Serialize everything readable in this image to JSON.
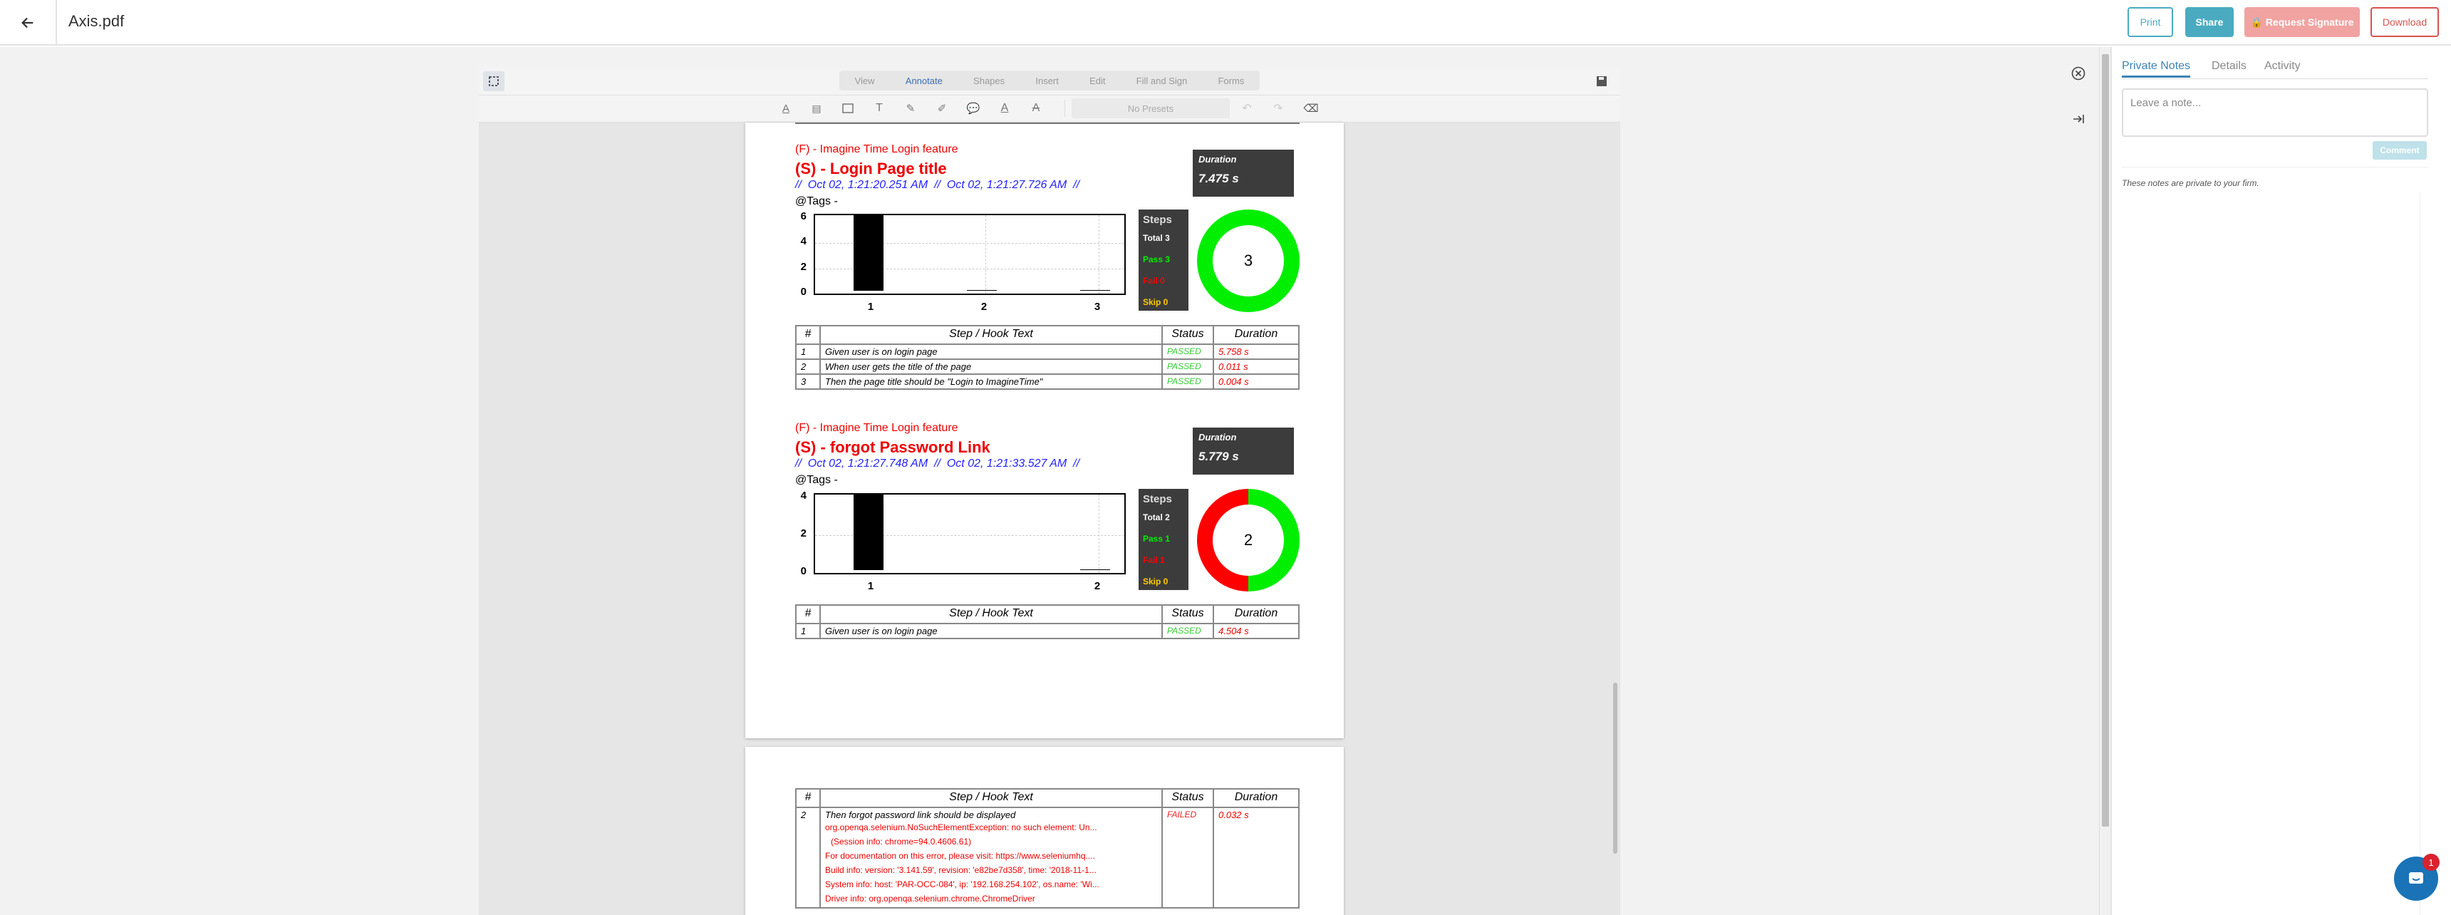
{
  "header": {
    "title": "Axis.pdf",
    "buttons": {
      "print": "Print",
      "share": "Share",
      "request_signature": "Request Signature",
      "download": "Download"
    }
  },
  "toolbar": {
    "tabs": [
      "View",
      "Annotate",
      "Shapes",
      "Insert",
      "Edit",
      "Fill and Sign",
      "Forms"
    ],
    "active_tab": "Annotate",
    "presets": "No Presets"
  },
  "report": {
    "scenario1": {
      "feature": "(F) - Imagine Time Login feature",
      "title": "(S) - Login Page title",
      "time": "//  Oct 02, 1:21:20.251 AM  //  Oct 02, 1:21:27.726 AM  //",
      "tags": "@Tags -",
      "duration_label": "Duration",
      "duration": "7.475 s",
      "steps_label": "Steps",
      "total": "Total 3",
      "pass": "Pass 3",
      "fail": "Fail 0",
      "skip": "Skip 0",
      "donut": "3",
      "chart": {
        "yticks": [
          "6",
          "4",
          "2",
          "0"
        ],
        "xticks": [
          "1",
          "2",
          "3"
        ],
        "values": [
          6,
          0,
          0
        ],
        "ymax": 6
      },
      "headers": [
        "#",
        "Step / Hook Text",
        "Status",
        "Duration"
      ],
      "rows": [
        {
          "n": "1",
          "text": "Given user is on login page",
          "status": "PASSED",
          "dur": "5.758 s"
        },
        {
          "n": "2",
          "text": "When user gets the title of the page",
          "status": "PASSED",
          "dur": "0.011 s"
        },
        {
          "n": "3",
          "text": "Then the page title should be \"Login to ImagineTime\"",
          "status": "PASSED",
          "dur": "0.004 s"
        }
      ]
    },
    "scenario2": {
      "feature": "(F) - Imagine Time Login feature",
      "title": "(S) - forgot Password Link",
      "time": "//  Oct 02, 1:21:27.748 AM  //  Oct 02, 1:21:33.527 AM  //",
      "tags": "@Tags -",
      "duration_label": "Duration",
      "duration": "5.779 s",
      "steps_label": "Steps",
      "total": "Total 2",
      "pass": "Pass 1",
      "fail": "Fail 1",
      "skip": "Skip 0",
      "donut": "2",
      "chart": {
        "yticks": [
          "4",
          "2",
          "0"
        ],
        "xticks": [
          "1",
          "2"
        ],
        "values": [
          4,
          0
        ],
        "ymax": 4
      },
      "headers": [
        "#",
        "Step / Hook Text",
        "Status",
        "Duration"
      ],
      "rows": [
        {
          "n": "1",
          "text": "Given user is on login page",
          "status": "PASSED",
          "dur": "4.504 s"
        }
      ]
    },
    "page2": {
      "headers": [
        "#",
        "Step / Hook Text",
        "Status",
        "Duration"
      ],
      "row": {
        "n": "2",
        "text": "Then forgot password link should be displayed",
        "status": "FAILED",
        "dur": "0.032 s",
        "errors": [
          "org.openqa.selenium.NoSuchElementException: no such element: Un...",
          "  (Session info: chrome=94.0.4606.61)",
          "For documentation on this error, please visit: https://www.seleniumhq....",
          "Build info: version: '3.141.59', revision: 'e82be7d358', time: '2018-11-1...",
          "System info: host: 'PAR-OCC-084', ip: '192.168.254.102', os.name: 'Wi...",
          "Driver info: org.openqa.selenium.chrome.ChromeDriver"
        ]
      }
    }
  },
  "panel": {
    "tabs": [
      "Private Notes",
      "Details",
      "Activity"
    ],
    "active": "Private Notes",
    "placeholder": "Leave a note...",
    "comment": "Comment",
    "note": "These notes are private to your firm."
  },
  "chat": {
    "badge": "1"
  },
  "colors": {
    "accent": "#4aabc0",
    "danger": "#d9534f",
    "pass": "#00ee00",
    "fail": "#ff0000",
    "skip": "#ffcc00"
  }
}
